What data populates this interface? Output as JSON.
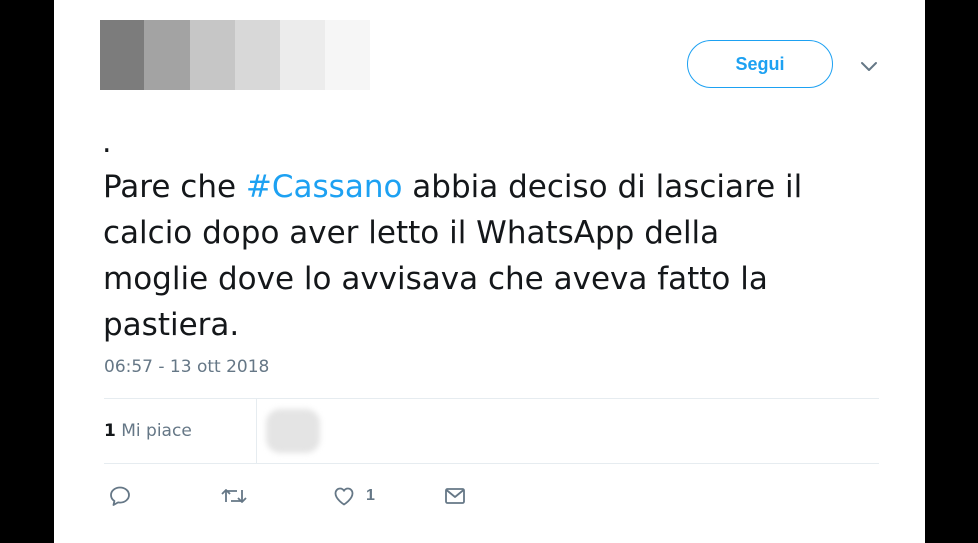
{
  "header": {
    "follow_label": "Segui",
    "caret_icon": "chevron-down-icon"
  },
  "tweet": {
    "dot": ".",
    "line1_prefix": "Pare che ",
    "hashtag": "#Cassano",
    "line1_suffix": " abbia deciso di lasciare il",
    "line2": "calcio dopo aver letto il WhatsApp della",
    "line3": "moglie dove lo avvisava che aveva fatto la",
    "line4": "pastiera.",
    "timestamp": "06:57 - 13 ott 2018"
  },
  "stats": {
    "likes_count": "1",
    "likes_label": "Mi piace"
  },
  "actions": {
    "reply_icon": "reply-icon",
    "retweet_icon": "retweet-icon",
    "like_icon": "heart-icon",
    "like_count": "1",
    "dm_icon": "mail-icon"
  },
  "colors": {
    "accent": "#1da1f2",
    "text": "#14171a",
    "muted": "#657786",
    "border": "#e6ecf0"
  }
}
